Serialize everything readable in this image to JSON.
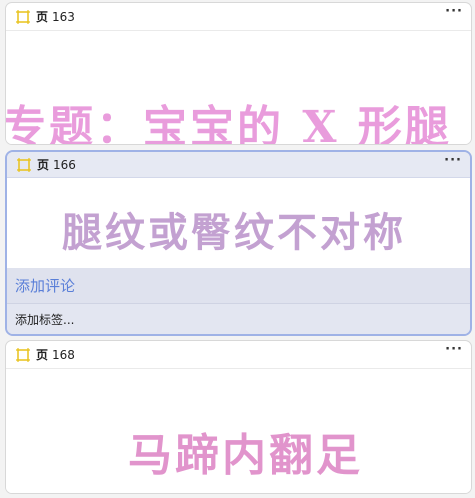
{
  "cards": [
    {
      "label": "页",
      "number": "163",
      "preview_text": "专题：宝宝的 X 形腿",
      "preview_color": "#e58bd6"
    },
    {
      "label": "页",
      "number": "166",
      "preview_text": "腿纹或臀纹不对称",
      "preview_color": "#b48ac6",
      "add_comment": "添加评论",
      "add_tag": "添加标签..."
    },
    {
      "label": "页",
      "number": "168",
      "preview_text": "马蹄内翻足",
      "preview_color": "#dc82c4"
    }
  ],
  "more_glyph": "···",
  "colors": {
    "icon": "#e8c21a",
    "accent": "#5a7fd8",
    "selected_border": "#9fb2e6"
  },
  "icons": {
    "page": "page-icon",
    "more": "more-icon"
  }
}
